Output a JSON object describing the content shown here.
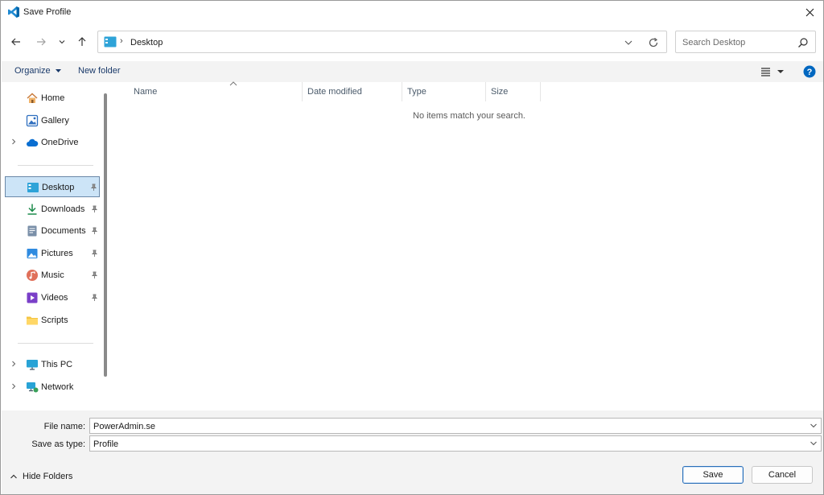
{
  "window": {
    "title": "Save Profile"
  },
  "nav": {
    "address": {
      "location": "Desktop"
    },
    "search": {
      "placeholder": "Search Desktop"
    }
  },
  "toolbar": {
    "organize_label": "Organize",
    "new_folder_label": "New folder"
  },
  "sidebar": {
    "items": [
      {
        "label": "Home",
        "icon": "home-icon"
      },
      {
        "label": "Gallery",
        "icon": "gallery-icon"
      },
      {
        "label": "OneDrive",
        "icon": "cloud-icon"
      },
      {
        "label": "Desktop",
        "icon": "desktop-icon",
        "selected": true
      },
      {
        "label": "Downloads",
        "icon": "download-icon"
      },
      {
        "label": "Documents",
        "icon": "document-icon"
      },
      {
        "label": "Pictures",
        "icon": "pictures-icon"
      },
      {
        "label": "Music",
        "icon": "music-icon"
      },
      {
        "label": "Videos",
        "icon": "video-icon"
      },
      {
        "label": "Scripts",
        "icon": "folder-icon"
      },
      {
        "label": "This PC",
        "icon": "computer-icon"
      },
      {
        "label": "Network",
        "icon": "network-icon"
      }
    ]
  },
  "list": {
    "columns": [
      {
        "label": "Name"
      },
      {
        "label": "Date modified"
      },
      {
        "label": "Type"
      },
      {
        "label": "Size"
      }
    ],
    "empty_message": "No items match your search."
  },
  "form": {
    "file_name_label": "File name:",
    "file_name_value": "PowerAdmin.se",
    "save_type_label": "Save as type:",
    "save_type_value": "Profile"
  },
  "footer": {
    "hide_folders_label": "Hide Folders",
    "save_label": "Save",
    "cancel_label": "Cancel"
  },
  "colors": {
    "accent": "#0067c0",
    "selection": "#cce4f7",
    "toolbar_bg": "#f3f3f3"
  }
}
